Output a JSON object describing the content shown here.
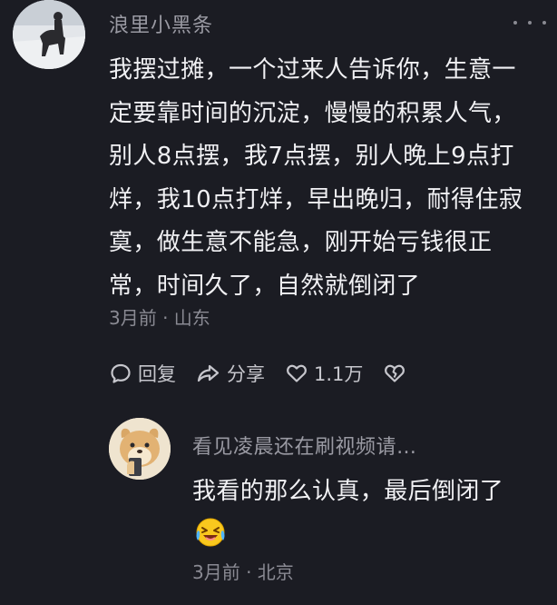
{
  "comment": {
    "username": "浪里小黑条",
    "text": "我摆过摊，一个过来人告诉你，生意一定要靠时间的沉淀，慢慢的积累人气，别人8点摆，我7点摆，别人晚上9点打烊，我10点打烊，早出晚归，耐得住寂寞，做生意不能急，刚开始亏钱很正常，时间久了，自然就倒闭了",
    "meta": "3月前 · 山东",
    "actions": {
      "reply_label": "回复",
      "share_label": "分享",
      "like_count": "1.1万"
    }
  },
  "reply": {
    "username": "看见凌晨还在刷视频请…",
    "text": "我看的那么认真，最后倒闭了",
    "emoji": "laughing-crying-face",
    "meta": "3月前 · 北京"
  }
}
